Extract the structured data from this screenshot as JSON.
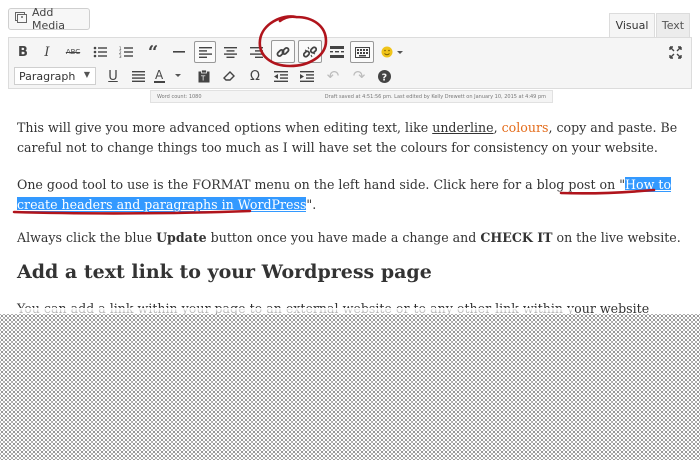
{
  "add_media": {
    "label": "Add Media",
    "icon": "media-icon"
  },
  "tabs": {
    "visual": "Visual",
    "text": "Text"
  },
  "expand_icon": "expand-icon",
  "toolbar": {
    "row1": [
      {
        "name": "bold-button",
        "glyph": "B"
      },
      {
        "name": "italic-button",
        "glyph": "I"
      },
      {
        "name": "strikethrough-button",
        "glyph": "ABC"
      },
      {
        "name": "bullet-list-button",
        "glyph": "≡"
      },
      {
        "name": "numbered-list-button",
        "glyph": "⅓"
      },
      {
        "name": "blockquote-button",
        "glyph": "❝"
      },
      {
        "name": "horizontal-line-button",
        "glyph": "—"
      },
      {
        "name": "align-left-button",
        "glyph": "≡"
      },
      {
        "name": "align-center-button",
        "glyph": "≡"
      },
      {
        "name": "align-right-button",
        "glyph": "≡"
      },
      {
        "name": "insert-link-button",
        "glyph": "🔗"
      },
      {
        "name": "remove-link-button",
        "glyph": "⛓"
      },
      {
        "name": "read-more-button",
        "glyph": "▭"
      },
      {
        "name": "toolbar-toggle-button",
        "glyph": "⌨"
      },
      {
        "name": "emoji-button",
        "glyph": "☺"
      }
    ],
    "row2": [
      {
        "name": "underline-button",
        "glyph": "U"
      },
      {
        "name": "justify-button",
        "glyph": "≣"
      },
      {
        "name": "text-color-button",
        "glyph": "A"
      },
      {
        "name": "paste-text-button",
        "glyph": "📋"
      },
      {
        "name": "clear-formatting-button",
        "glyph": "⌫"
      },
      {
        "name": "special-character-button",
        "glyph": "Ω"
      },
      {
        "name": "outdent-button",
        "glyph": "⇤"
      },
      {
        "name": "indent-button",
        "glyph": "⇥"
      },
      {
        "name": "undo-button",
        "glyph": "↶"
      },
      {
        "name": "redo-button",
        "glyph": "↷"
      },
      {
        "name": "help-button",
        "glyph": "?"
      }
    ],
    "format_value": "Paragraph"
  },
  "word_count_strip": {
    "left": "Word count: 1080",
    "right": "Draft saved at 4:51:56 pm. Last edited by Kelly Drewett on January 10, 2015 at 4:49 pm"
  },
  "content": {
    "p1": {
      "before": "This will give you more advanced options when editing text, like ",
      "underline": "underline",
      "sep1": ", ",
      "colours": "colours",
      "after": ", copy and paste.  Be careful not to change things too much as I will have set the colours for consistency on your website."
    },
    "p2": {
      "before": "One good tool to use is the FORMAT menu on the left hand side.  Click here for a blog post on \"",
      "link": "How to create headers and paragraphs in WordPress",
      "after": "\"."
    },
    "p3": {
      "before": "Always click the blue ",
      "bold1": "Update",
      "middle": " button once you have made a change and ",
      "bold2": "CHECK IT",
      "after": " on the live website."
    },
    "heading": "Add a text link to your Wordpress page",
    "p4": "You can add a link within your page to an external website or to any other link within your website"
  },
  "annotation_color": "#b0141c",
  "highlight_color": "#3399ff"
}
